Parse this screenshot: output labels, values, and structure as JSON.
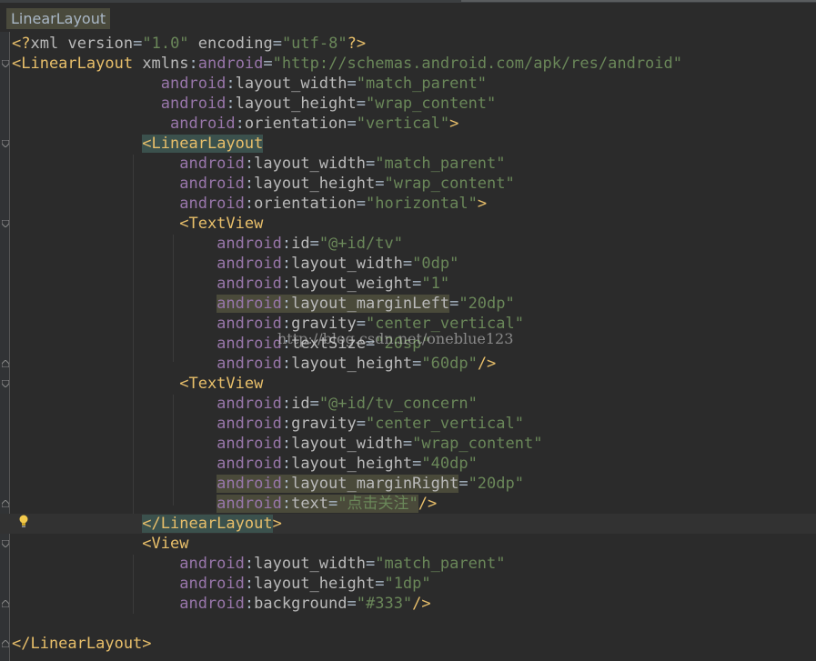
{
  "breadcrumb": {
    "label": "LinearLayout"
  },
  "watermark": "http://blog.csdn.net/oneblue123",
  "icons": {
    "intention": "lightbulb-icon",
    "fold": "fold-marker-icon"
  },
  "colors": {
    "background": "#2b2b2b",
    "tag": "#e8bf6a",
    "namespace": "#9876aa",
    "value": "#6a8759",
    "text": "#a9b7c6"
  },
  "code": {
    "l1": {
      "open": "<?",
      "name": "xml",
      "a1": "version",
      "v1": "\"1.0\"",
      "a2": "encoding",
      "v2": "\"utf-8\"",
      "close": "?>"
    },
    "l2": {
      "tag": "<LinearLayout",
      "xmlns": "xmlns",
      "ns": "android",
      "eq": "=",
      "val": "\"http://schemas.android.com/apk/res/android\""
    },
    "l3": {
      "ns": "android",
      "attr": "layout_width",
      "val": "\"match_parent\""
    },
    "l4": {
      "ns": "android",
      "attr": "layout_height",
      "val": "\"wrap_content\""
    },
    "l5": {
      "ns": "android",
      "attr": "orientation",
      "val": "\"vertical\"",
      "close": ">"
    },
    "l6": {
      "lt": "<",
      "tag": "LinearLayout"
    },
    "l7": {
      "ns": "android",
      "attr": "layout_width",
      "val": "\"match_parent\""
    },
    "l8": {
      "ns": "android",
      "attr": "layout_height",
      "val": "\"wrap_content\""
    },
    "l9": {
      "ns": "android",
      "attr": "orientation",
      "val": "\"horizontal\"",
      "close": ">"
    },
    "l10": {
      "tag": "<TextView"
    },
    "l11": {
      "ns": "android",
      "attr": "id",
      "val": "\"@+id/tv\""
    },
    "l12": {
      "ns": "android",
      "attr": "layout_width",
      "val": "\"0dp\""
    },
    "l13": {
      "ns": "android",
      "attr": "layout_weight",
      "val": "\"1\""
    },
    "l14": {
      "ns": "android",
      "attr": "layout_marginLeft",
      "val": "\"20dp\""
    },
    "l15": {
      "ns": "android",
      "attr": "gravity",
      "val": "\"center_vertical\""
    },
    "l16": {
      "ns": "android",
      "attr": "textSize",
      "val": "\"20sp\""
    },
    "l17": {
      "ns": "android",
      "attr": "layout_height",
      "val": "\"60dp\"",
      "close": "/>"
    },
    "l18": {
      "tag": "<TextView"
    },
    "l19": {
      "ns": "android",
      "attr": "id",
      "val": "\"@+id/tv_concern\""
    },
    "l20": {
      "ns": "android",
      "attr": "gravity",
      "val": "\"center_vertical\""
    },
    "l21": {
      "ns": "android",
      "attr": "layout_width",
      "val": "\"wrap_content\""
    },
    "l22": {
      "ns": "android",
      "attr": "layout_height",
      "val": "\"40dp\""
    },
    "l23": {
      "ns": "android",
      "attr": "layout_marginRight",
      "val": "\"20dp\""
    },
    "l24": {
      "ns": "android",
      "attr": "text",
      "q1": "\"",
      "txt": "点击关注",
      "q2": "\"",
      "close": "/>"
    },
    "l25": {
      "tag": "</LinearLayout",
      "close": ">"
    },
    "l26": {
      "tag": "<View"
    },
    "l27": {
      "ns": "android",
      "attr": "layout_width",
      "val": "\"match_parent\""
    },
    "l28": {
      "ns": "android",
      "attr": "layout_height",
      "val": "\"1dp\""
    },
    "l29": {
      "ns": "android",
      "attr": "background",
      "val": "\"#333\"",
      "close": "/>"
    },
    "l30": {},
    "l31": {
      "tag": "</LinearLayout",
      "close": ">"
    }
  }
}
